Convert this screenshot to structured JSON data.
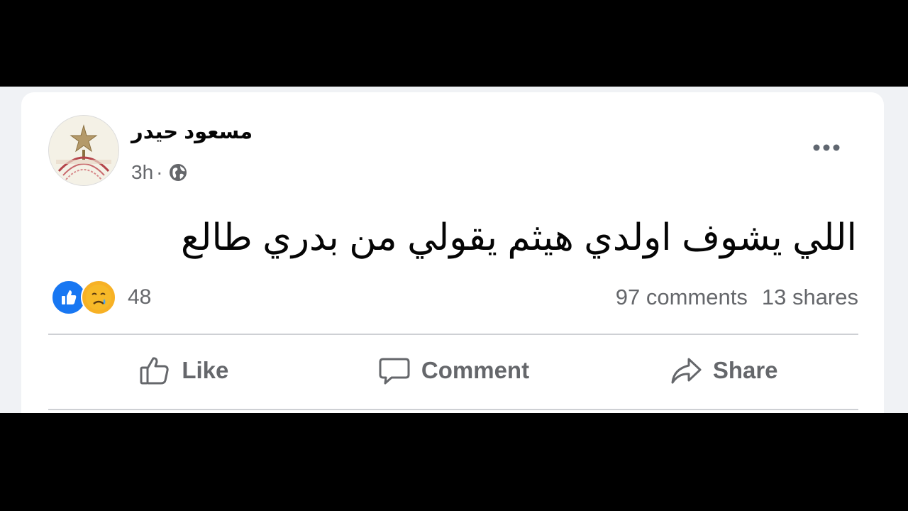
{
  "post": {
    "author": "مسعود حيدر",
    "time": "3h",
    "separator": "·",
    "privacy_icon": "globe-icon",
    "text": "اللي يشوف اولدي هيثم يقولي من بدري طالع",
    "more_icon": "more-options-icon"
  },
  "reactions": {
    "icons": [
      "like-reaction-icon",
      "care-reaction-icon"
    ],
    "count": "48"
  },
  "stats": {
    "comments": "97 comments",
    "shares": "13 shares"
  },
  "actions": {
    "like_label": "Like",
    "comment_label": "Comment",
    "share_label": "Share"
  },
  "colors": {
    "like_blue": "#1877f2",
    "secondary_text": "#65676b",
    "divider": "#ced0d4"
  }
}
